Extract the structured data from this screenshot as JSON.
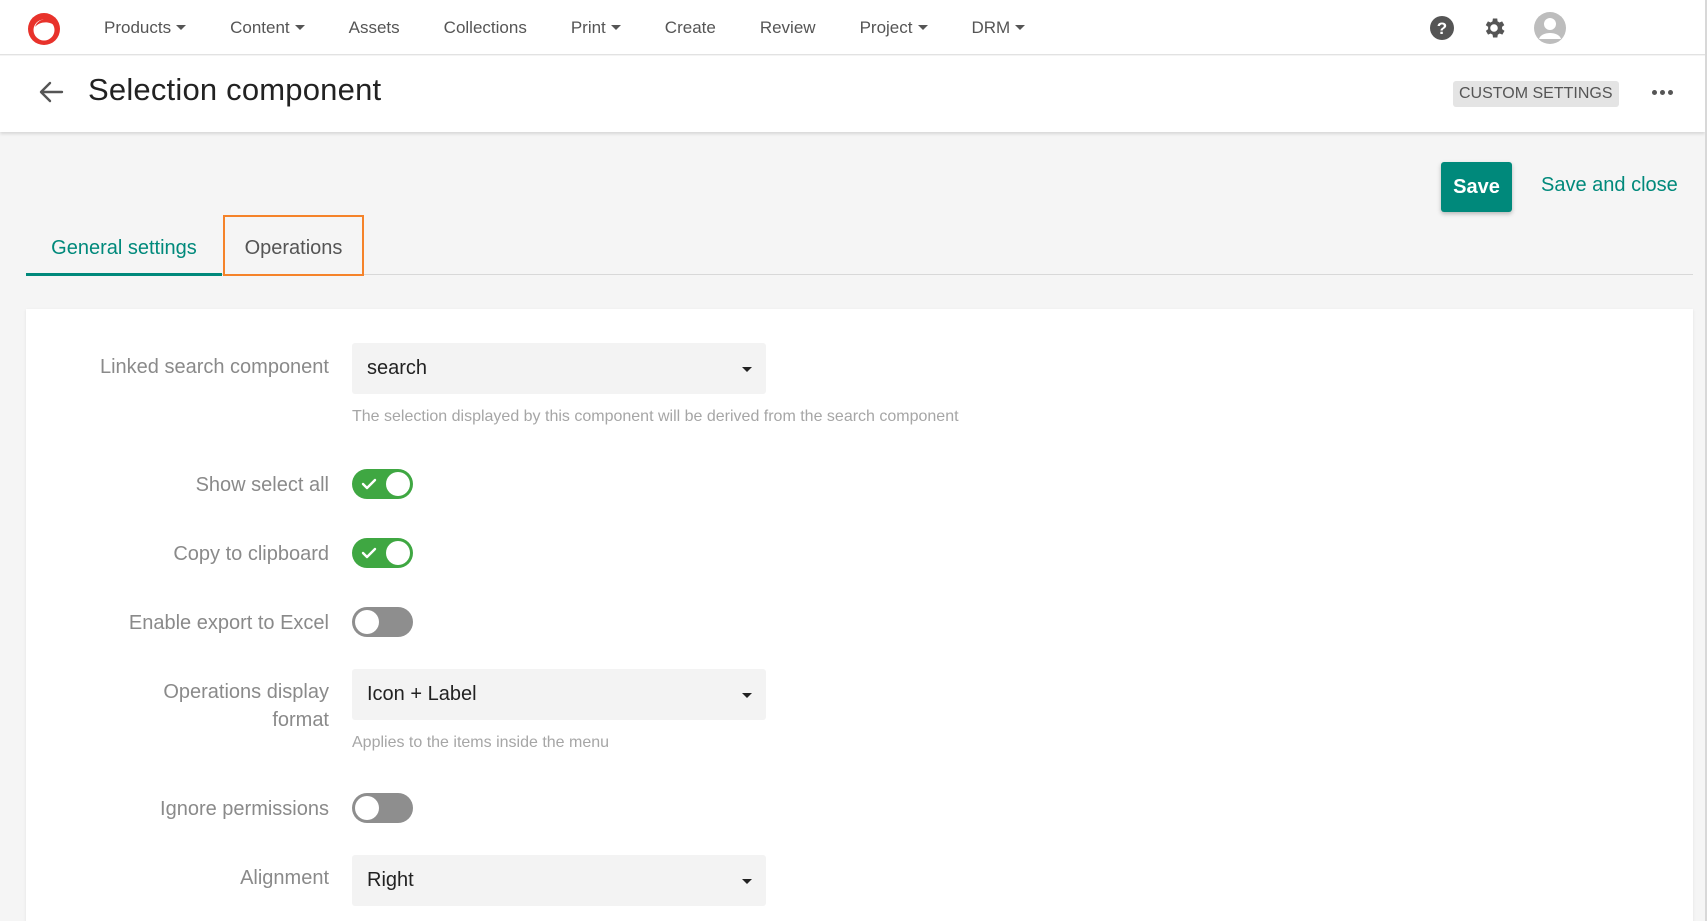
{
  "nav": {
    "items": [
      {
        "label": "Products",
        "dropdown": true
      },
      {
        "label": "Content",
        "dropdown": true
      },
      {
        "label": "Assets",
        "dropdown": false
      },
      {
        "label": "Collections",
        "dropdown": false
      },
      {
        "label": "Print",
        "dropdown": true
      },
      {
        "label": "Create",
        "dropdown": false
      },
      {
        "label": "Review",
        "dropdown": false
      },
      {
        "label": "Project",
        "dropdown": true
      },
      {
        "label": "DRM",
        "dropdown": true
      }
    ],
    "icons": [
      "help-icon",
      "gear-icon",
      "user-avatar-icon"
    ]
  },
  "header": {
    "title": "Selection component",
    "badge": "CUSTOM SETTINGS"
  },
  "actions": {
    "save_label": "Save",
    "save_close_label": "Save and close"
  },
  "tabs": {
    "general": "General settings",
    "operations": "Operations"
  },
  "form": {
    "linked_search": {
      "label": "Linked search component",
      "value": "search",
      "help": "The selection displayed by this component will be derived from the search component"
    },
    "show_select_all": {
      "label": "Show select all",
      "on": true
    },
    "copy_clipboard": {
      "label": "Copy to clipboard",
      "on": true
    },
    "export_excel": {
      "label": "Enable export to Excel",
      "on": false
    },
    "ops_format": {
      "label_line1": "Operations display",
      "label_line2": "format",
      "value": "Icon + Label",
      "help": "Applies to the items inside the menu"
    },
    "ignore_permissions": {
      "label": "Ignore permissions",
      "on": false
    },
    "alignment": {
      "label": "Alignment",
      "value": "Right"
    }
  },
  "colors": {
    "accent": "#00897b",
    "toggle_on": "#3fa742",
    "toggle_off": "#8e8e8e",
    "tab_highlight": "#f5832a",
    "logo": "#e8322b"
  }
}
